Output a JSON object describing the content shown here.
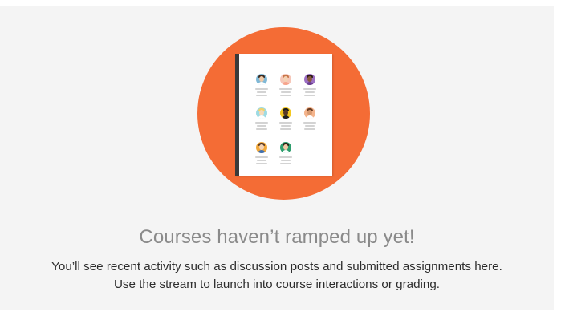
{
  "empty_state": {
    "title": "Courses haven’t ramped up yet!",
    "line1": "You’ll see recent activity such as discussion posts and submitted assignments here.",
    "line2": "Use the stream to launch into course interactions or grading."
  },
  "illustration": {
    "icon": "roster-document-icon",
    "circle_color": "#f46c35",
    "avatars": [
      {
        "bg": "#7fb8d6",
        "face": "#f1c9a5",
        "hair": "#3b2a20",
        "body": "#ffffff"
      },
      {
        "bg": "#f6c7b9",
        "face": "#f4d2b4",
        "hair": "#c7764a",
        "body": "#f7a48c"
      },
      {
        "bg": "#9c6fc3",
        "face": "#8a5a3c",
        "hair": "#2b1c14",
        "body": "#6c3f8f"
      },
      {
        "bg": "#9edbe3",
        "face": "#f6d9b8",
        "hair": "#f1d36b",
        "body": "#ffffff"
      },
      {
        "bg": "#f4c81f",
        "face": "#5a3a24",
        "hair": "#1f1f1f",
        "body": "#1f1f1f"
      },
      {
        "bg": "#f4b48c",
        "face": "#d89a70",
        "hair": "#6b3e24",
        "body": "#ffffff"
      },
      {
        "bg": "#f2a93b",
        "face": "#f4d2b4",
        "hair": "#5a3a24",
        "body": "#3b6fb5"
      },
      {
        "bg": "#2e9e6d",
        "face": "#f1c9a5",
        "hair": "#2b1c14",
        "body": "#ffffff"
      }
    ]
  }
}
